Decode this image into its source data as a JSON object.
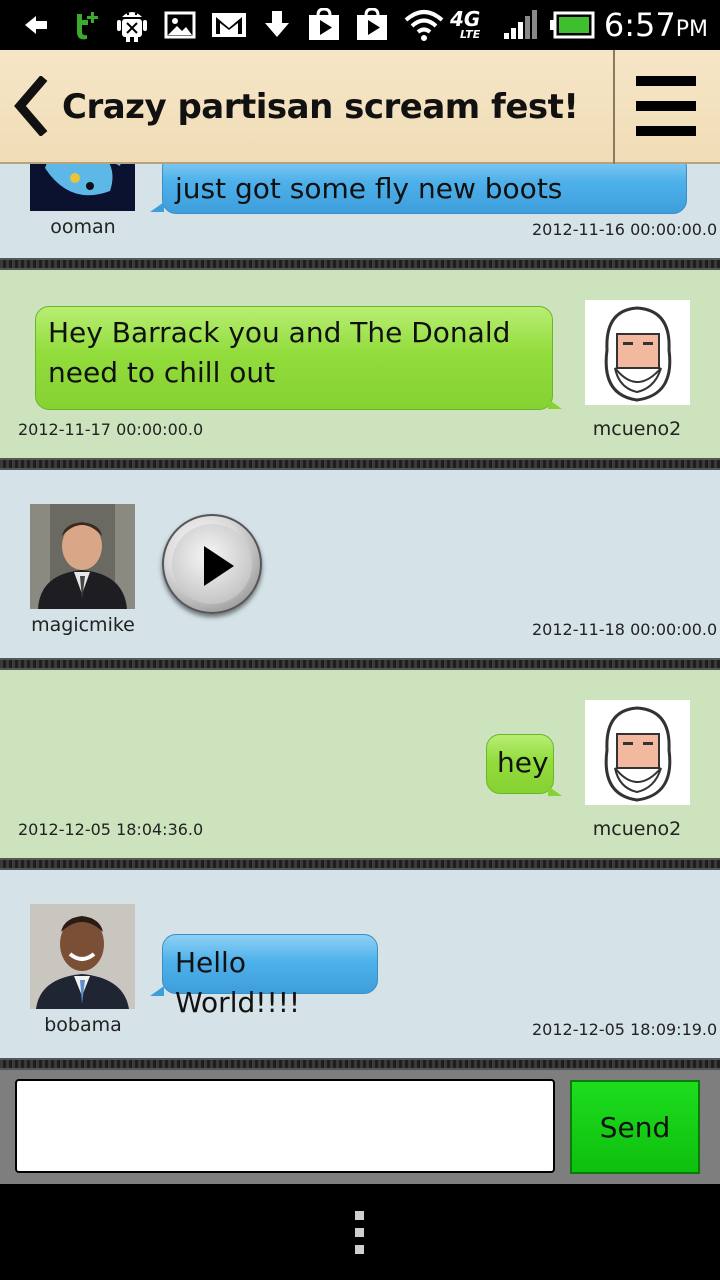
{
  "status_bar": {
    "time": "6:57",
    "ampm": "PM",
    "network": "4G",
    "network_sub": "LTE",
    "icons": [
      "back-arrow-icon",
      "tplus-icon",
      "android-debug-icon",
      "gallery-icon",
      "gmail-icon",
      "download-icon",
      "play-store-icon",
      "play-store-icon",
      "wifi-icon",
      "4g-lte-icon",
      "signal-icon",
      "battery-icon"
    ]
  },
  "header": {
    "title": "Crazy partisan scream fest!"
  },
  "messages": [
    {
      "user": "ooman",
      "text": "just got some fly new boots",
      "timestamp": "2012-11-16 00:00:00.0",
      "side": "left",
      "color": "blue"
    },
    {
      "user": "mcueno2",
      "text": "Hey Barrack you and The Donald need to chill out",
      "timestamp": "2012-11-17 00:00:00.0",
      "side": "right",
      "color": "green"
    },
    {
      "user": "magicmike",
      "text": "",
      "attachment": "audio-play",
      "timestamp": "2012-11-18 00:00:00.0",
      "side": "left",
      "color": "blue"
    },
    {
      "user": "mcueno2",
      "text": "hey",
      "timestamp": "2012-12-05 18:04:36.0",
      "side": "right",
      "color": "green"
    },
    {
      "user": "bobama",
      "text": "Hello World!!!!",
      "timestamp": "2012-12-05 18:09:19.0",
      "side": "left",
      "color": "blue"
    }
  ],
  "composer": {
    "input_value": "",
    "send_label": "Send"
  },
  "colors": {
    "blue_row": "#d5e3e9",
    "green_row": "#cde3bd",
    "blue_bubble": "#4fb1ea",
    "green_bubble": "#92dc3c",
    "send_button": "#14d014"
  }
}
